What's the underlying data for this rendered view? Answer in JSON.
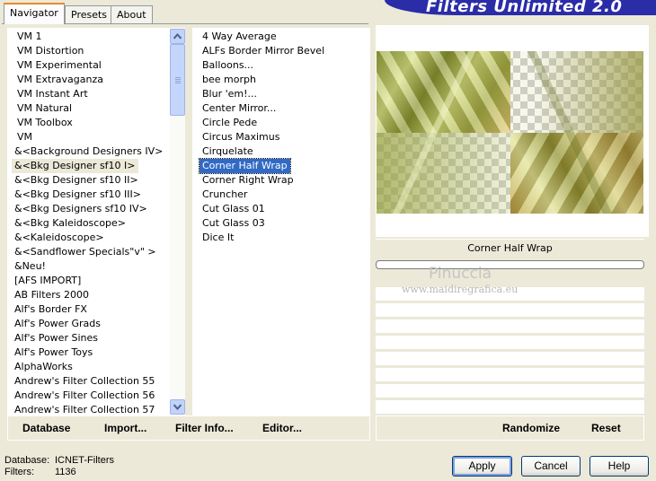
{
  "window": {
    "title": "Filters Unlimited 2.0"
  },
  "tabs": [
    {
      "label": "Navigator",
      "active": true
    },
    {
      "label": "Presets",
      "active": false
    },
    {
      "label": "About",
      "active": false
    }
  ],
  "categories": {
    "items": [
      "VM 1",
      "VM Distortion",
      "VM Experimental",
      "VM Extravaganza",
      "VM Instant Art",
      "VM Natural",
      "VM Toolbox",
      "VM",
      "&<Background Designers IV>",
      "&<Bkg Designer sf10 I>",
      "&<Bkg Designer sf10 II>",
      "&<Bkg Designer sf10 III>",
      "&<Bkg Designers sf10 IV>",
      "&<Bkg Kaleidoscope>",
      "&<Kaleidoscope>",
      "&<Sandflower Specials\"v\" >",
      "&Neu!",
      "[AFS IMPORT]",
      "AB Filters 2000",
      "Alf's Border FX",
      "Alf's Power Grads",
      "Alf's Power Sines",
      "Alf's Power Toys",
      "AlphaWorks",
      "Andrew's Filter Collection 55",
      "Andrew's Filter Collection 56",
      "Andrew's Filter Collection 57"
    ],
    "selected_index": 9
  },
  "filters": {
    "items": [
      "4 Way Average",
      "ALFs Border Mirror Bevel",
      "Balloons...",
      "bee morph",
      "Blur 'em!...",
      "Center Mirror...",
      "Circle Pede",
      "Circus Maximus",
      "Cirquelate",
      "Corner Half Wrap",
      "Corner Right Wrap",
      "Cruncher",
      "Cut Glass  01",
      "Cut Glass  03",
      "Dice It"
    ],
    "selected_index": 9
  },
  "preview": {
    "filter_name": "Corner Half Wrap"
  },
  "watermark": {
    "line1": "Pinuccia",
    "line2": "www.maidiregrafica.eu"
  },
  "toolbar": {
    "database": "Database",
    "import": "Import...",
    "filter_info": "Filter Info...",
    "editor": "Editor...",
    "randomize": "Randomize",
    "reset": "Reset"
  },
  "status": {
    "database_label": "Database:",
    "database_value": "ICNET-Filters",
    "filters_label": "Filters:",
    "filters_value": "1136"
  },
  "buttons": {
    "apply": "Apply",
    "cancel": "Cancel",
    "help": "Help"
  },
  "colors": {
    "selection": "#316ac5",
    "banner": "#2a2ca8",
    "dialog": "#ece9d8"
  }
}
